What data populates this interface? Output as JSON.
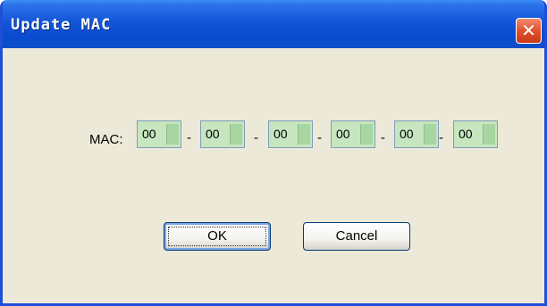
{
  "window": {
    "title": "Update MAC",
    "close_symbol": "✕"
  },
  "form": {
    "mac_label": "MAC:",
    "octets": [
      "00",
      "00",
      "00",
      "00",
      "00",
      "00"
    ],
    "separator": "-"
  },
  "buttons": {
    "ok_label": "OK",
    "cancel_label": "Cancel"
  },
  "colors": {
    "titlebar": "#0a4bd0",
    "dialog_bg": "#ece9d8",
    "field_bg": "#c7e6c0",
    "close_btn": "#e0522d"
  },
  "icons": {
    "close": "close-icon"
  }
}
